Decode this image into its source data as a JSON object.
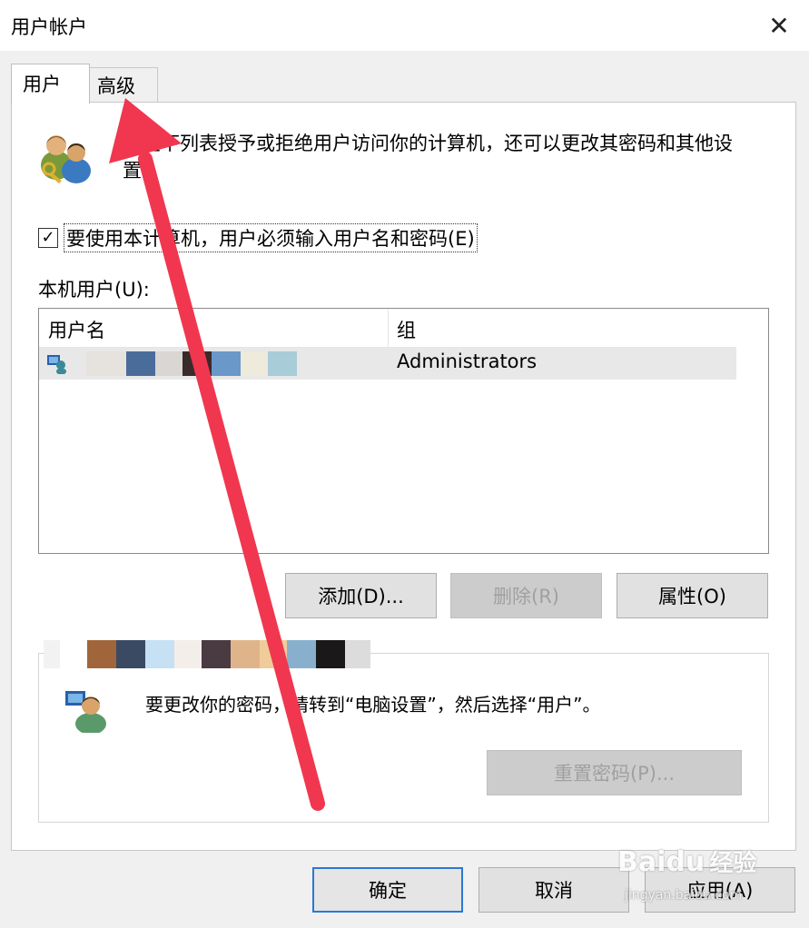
{
  "window": {
    "title": "用户帐户",
    "close_glyph": "✕"
  },
  "tabs": [
    {
      "label": "用户",
      "active": true
    },
    {
      "label": "高级",
      "active": false
    }
  ],
  "description": "要在下列表授予或拒绝用户访问你的计算机，还可以更改其密码和其他设置。",
  "require_login": {
    "checked": true,
    "check_glyph": "✓",
    "label": "要使用本计算机，用户必须输入用户名和密码(E)"
  },
  "local_users": {
    "label": "本机用户(U):",
    "columns": [
      "用户名",
      "组"
    ],
    "rows": [
      {
        "username": "",
        "group": "Administrators"
      }
    ]
  },
  "list_buttons": {
    "add": "添加(D)...",
    "remove": "删除(R)",
    "properties": "属性(O)"
  },
  "password_section": {
    "text": "要更改你的密码，请转到“电脑设置”，然后选择“用户”。",
    "reset_button": "重置密码(P)..."
  },
  "dialog_buttons": {
    "ok": "确定",
    "cancel": "取消",
    "apply": "应用(A)"
  },
  "watermark": {
    "brand": "Baidu",
    "suffix": "经验",
    "url": "jingyan.baidu.com"
  },
  "colors": {
    "arrow": "#f0374f",
    "ok_border": "#2a78d6",
    "redaction_row": [
      "#e6e2de",
      "#4a6c9a",
      "#dad6d3",
      "#3a2a2a",
      "#6a98c8",
      "#eeeadc",
      "#a8ccd8"
    ],
    "redaction_section": [
      "#f2f2f2",
      "#a0653a",
      "#3a4a62",
      "#c6e0f4",
      "#f4eeea",
      "#4a3a42",
      "#e0b48a",
      "#f0cc9a",
      "#88b0cc",
      "#1a1818",
      "#dcdcdc"
    ]
  }
}
